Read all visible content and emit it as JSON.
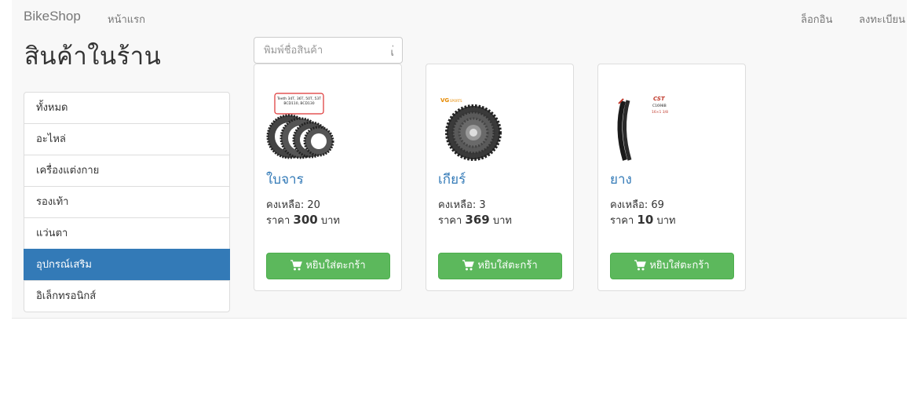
{
  "navbar": {
    "brand": "BikeShop",
    "home": "หน้าแรก",
    "login": "ล็อกอิน",
    "register": "ลงทะเบียน"
  },
  "page": {
    "title": "สินค้าในร้าน"
  },
  "search": {
    "placeholder": "พิมพ์ชื่อสินค้า",
    "button": "เ่"
  },
  "categories": [
    {
      "label": "ทั้งหมด",
      "active": false
    },
    {
      "label": "อะไหล่",
      "active": false
    },
    {
      "label": "เครื่องแต่งกาย",
      "active": false
    },
    {
      "label": "รองเท้า",
      "active": false
    },
    {
      "label": "แว่นตา",
      "active": false
    },
    {
      "label": "อุปกรณ์เสริม",
      "active": true
    },
    {
      "label": "อิเล็กทรอนิกส์",
      "active": false
    }
  ],
  "products": [
    {
      "name": "ใบจาร",
      "stock_label": "คงเหลือ:",
      "stock": "20",
      "price_label": "ราคา",
      "price": "300",
      "currency": "บาท",
      "button": "หยิบใส่ตะกร้า",
      "image": "chainring-image",
      "image_text": [
        "Teeth 34T, 36T, 50T, 53T",
        "BCD110, BCD130"
      ]
    },
    {
      "name": "เกียร์",
      "stock_label": "คงเหลือ:",
      "stock": "3",
      "price_label": "ราคา",
      "price": "369",
      "currency": "บาท",
      "button": "หยิบใส่ตะกร้า",
      "image": "cassette-image",
      "image_text": [
        "VG",
        "SPORTS"
      ]
    },
    {
      "name": "ยาง",
      "stock_label": "คงเหลือ:",
      "stock": "69",
      "price_label": "ราคา",
      "price": "10",
      "currency": "บาท",
      "button": "หยิบใส่ตะกร้า",
      "image": "tire-image",
      "image_text": [
        "CST",
        "C1698B",
        "16×1 3/8"
      ]
    }
  ],
  "colors": {
    "accent": "#337ab7",
    "cart_button": "#5cb85c",
    "navbar_bg": "#f8f8f8"
  }
}
